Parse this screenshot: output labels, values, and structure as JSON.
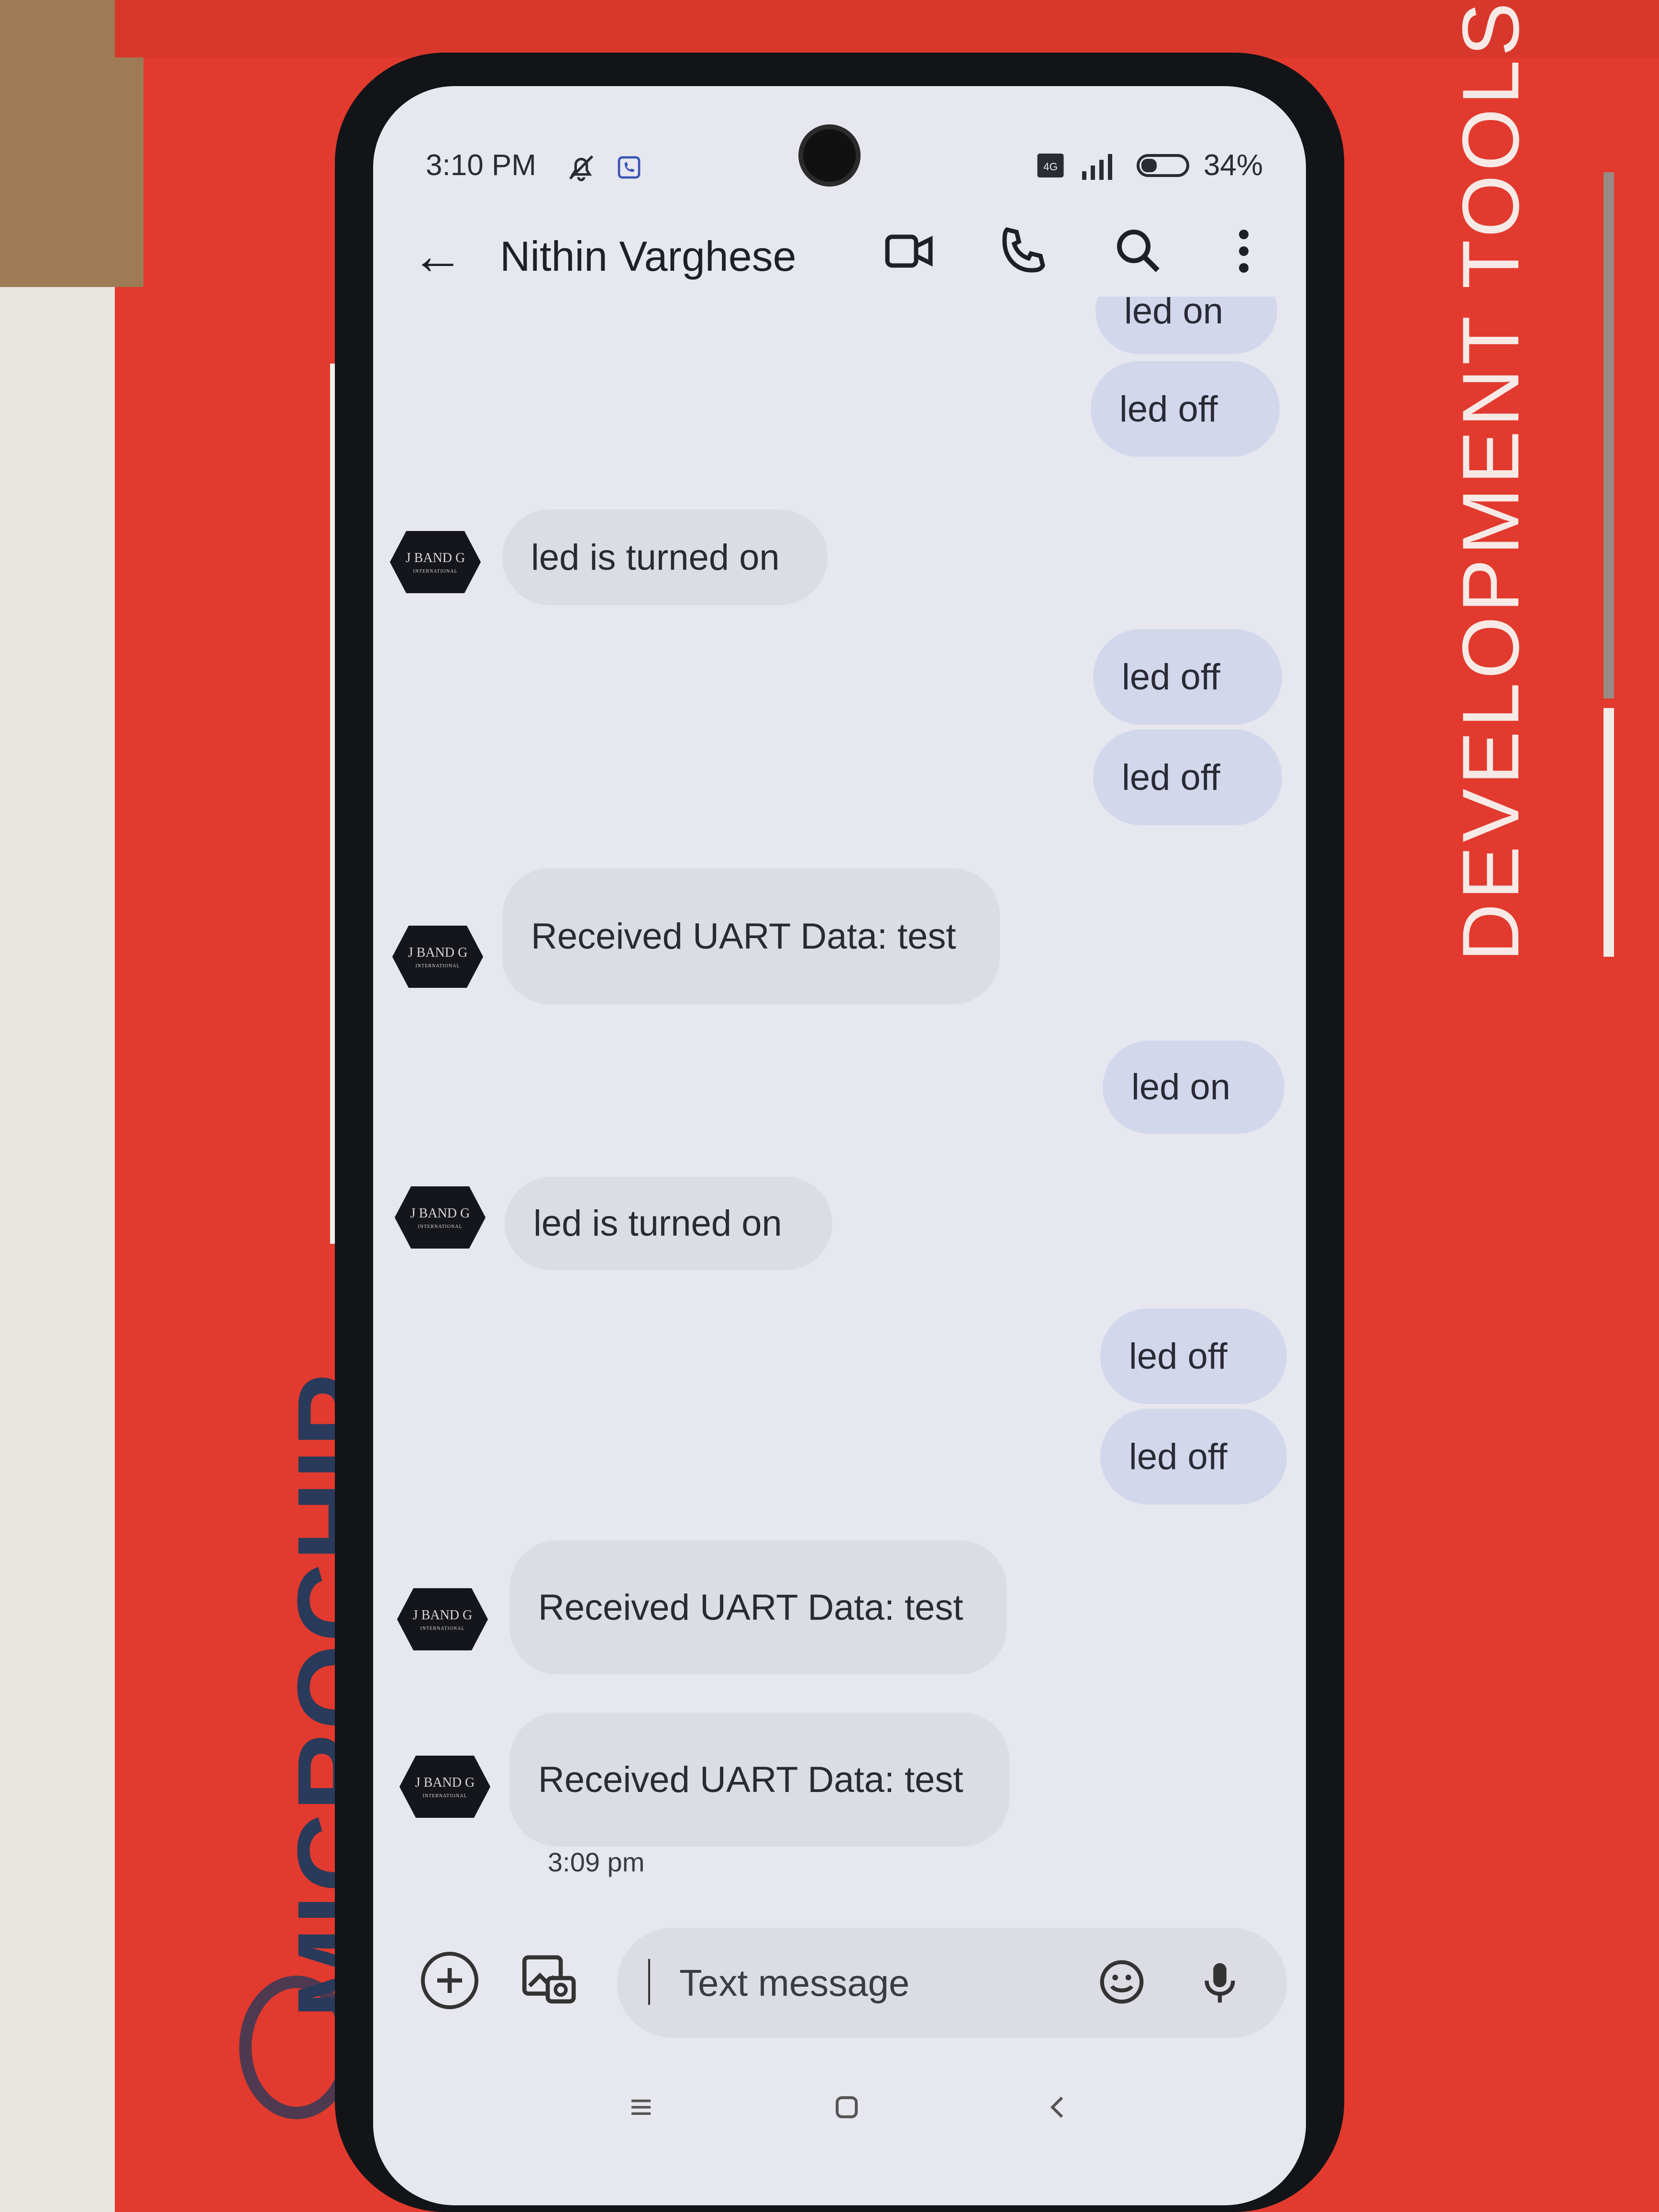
{
  "status_bar": {
    "time": "3:10 PM",
    "battery": "34%"
  },
  "app_bar": {
    "contact_name": "Nithin Varghese"
  },
  "avatar": {
    "text": "J BAND G",
    "subtext": "INTERNATIONAL"
  },
  "messages": [
    {
      "direction": "out",
      "text": "led on"
    },
    {
      "direction": "out",
      "text": "led off"
    },
    {
      "direction": "in",
      "text": "led is turned on"
    },
    {
      "direction": "out",
      "text": "led off"
    },
    {
      "direction": "out",
      "text": "led off"
    },
    {
      "direction": "in",
      "text": "Received UART Data: test"
    },
    {
      "direction": "out",
      "text": "led on"
    },
    {
      "direction": "in",
      "text": "led is turned on"
    },
    {
      "direction": "out",
      "text": "led off"
    },
    {
      "direction": "out",
      "text": "led off"
    },
    {
      "direction": "in",
      "text": "Received UART Data: test"
    },
    {
      "direction": "in",
      "text": "Received UART Data: test"
    }
  ],
  "last_timestamp": "3:09 pm",
  "composer": {
    "placeholder": "Text message"
  },
  "background": {
    "box_text": "DEVELOPMENT TOOLS",
    "brand_text": "MICROCHIP"
  }
}
